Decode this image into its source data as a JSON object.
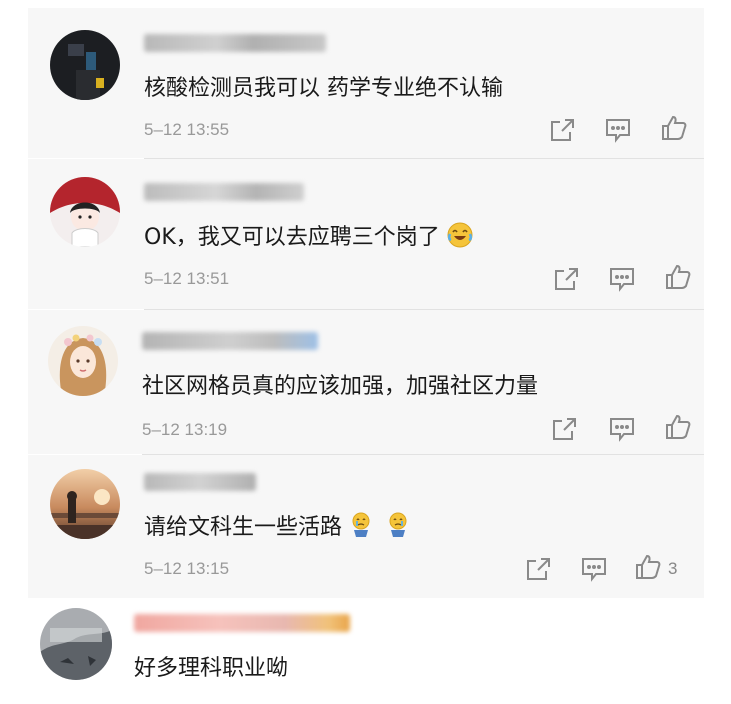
{
  "comments": [
    {
      "text": "核酸检测员我可以 药学专业绝不认输",
      "time": "5–12 13:55",
      "actions": {
        "forward": "share-icon",
        "comment": "comment-icon",
        "like": "thumbs-up-icon"
      }
    },
    {
      "text": "OK，我又可以去应聘三个岗了",
      "emoji": "laughing-tears-emoji",
      "time": "5–12 13:51",
      "actions": {
        "forward": "share-icon",
        "comment": "comment-icon",
        "like": "thumbs-up-icon"
      }
    },
    {
      "text": "社区网格员真的应该加强，加强社区力量",
      "time": "5–12 13:19",
      "actions": {
        "forward": "share-icon",
        "comment": "comment-icon",
        "like": "thumbs-up-icon"
      }
    },
    {
      "text": "请给文科生一些活路",
      "emoji": "crying-figure-emoji",
      "time": "5–12 13:15",
      "like_count": "3",
      "actions": {
        "forward": "share-icon",
        "comment": "comment-icon",
        "like": "thumbs-up-icon"
      }
    },
    {
      "text": "好多理科职业呦"
    }
  ],
  "colors": {
    "card_bg": "#f7f7f7",
    "text": "#1a1a1a",
    "meta": "#999999",
    "icon": "#8a8a8a"
  }
}
